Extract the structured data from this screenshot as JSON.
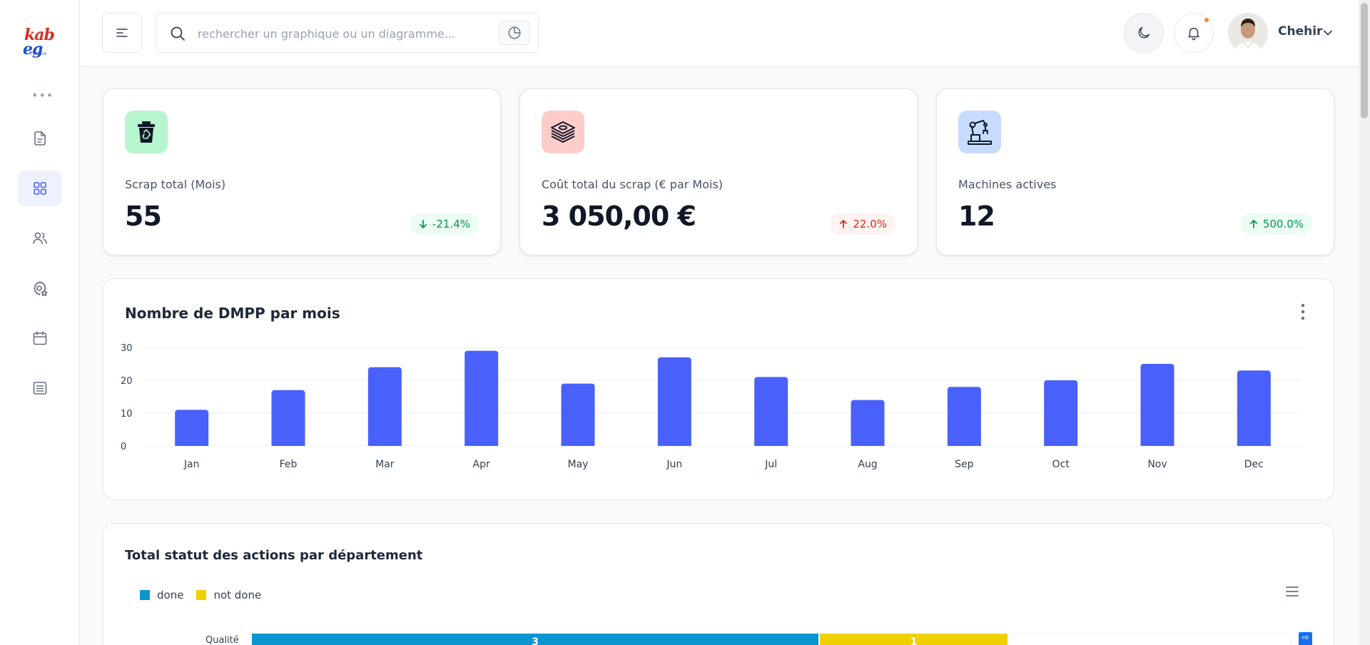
{
  "brand": {
    "logo_line1": "kab",
    "logo_line2": "eg",
    "logo_line3": "TUNISIA"
  },
  "sidebar": {
    "more_label": "•••",
    "items": [
      {
        "icon": "file-icon"
      },
      {
        "icon": "grid-icon",
        "active": true
      },
      {
        "icon": "users-icon"
      },
      {
        "icon": "settings-icon"
      },
      {
        "icon": "calendar-icon"
      },
      {
        "icon": "list-icon"
      }
    ]
  },
  "header": {
    "search_placeholder": "rechercher un graphique ou un diagramme...",
    "user_name": "Chehir"
  },
  "stats": [
    {
      "label": "Scrap total (Mois)",
      "value": "55",
      "change": "-21.4%",
      "direction": "down",
      "icon_bg": "#b7f5cf"
    },
    {
      "label": "Coût total du scrap (€ par Mois)",
      "value": "3 050,00 €",
      "change": "22.0%",
      "direction": "up",
      "icon_bg": "#fecdca"
    },
    {
      "label": "Machines actives",
      "value": "12",
      "change": "500.0%",
      "direction": "up",
      "icon_bg": "#c6dbff"
    }
  ],
  "dmpp_chart": {
    "title": "Nombre de DMPP par mois",
    "chart_data": {
      "type": "bar",
      "categories": [
        "Jan",
        "Feb",
        "Mar",
        "Apr",
        "May",
        "Jun",
        "Jul",
        "Aug",
        "Sep",
        "Oct",
        "Nov",
        "Dec"
      ],
      "values": [
        11,
        17,
        24,
        29,
        19,
        27,
        21,
        14,
        18,
        20,
        25,
        23
      ],
      "ylim": [
        0,
        30
      ],
      "yticks": [
        0,
        10,
        20,
        30
      ],
      "grid": true,
      "color": "#4961fa"
    }
  },
  "status_chart": {
    "title": "Total statut des actions par département",
    "legend": [
      {
        "label": "done",
        "color": "#0b95d0"
      },
      {
        "label": "not done",
        "color": "#f0d000"
      }
    ],
    "chart_data": {
      "type": "bar",
      "orientation": "horizontal",
      "stacked": true,
      "categories": [
        "Qualité"
      ],
      "series": [
        {
          "name": "done",
          "values": [
            3
          ]
        },
        {
          "name": "not done",
          "values": [
            1
          ]
        }
      ],
      "xlim": [
        0,
        5.5
      ]
    }
  }
}
